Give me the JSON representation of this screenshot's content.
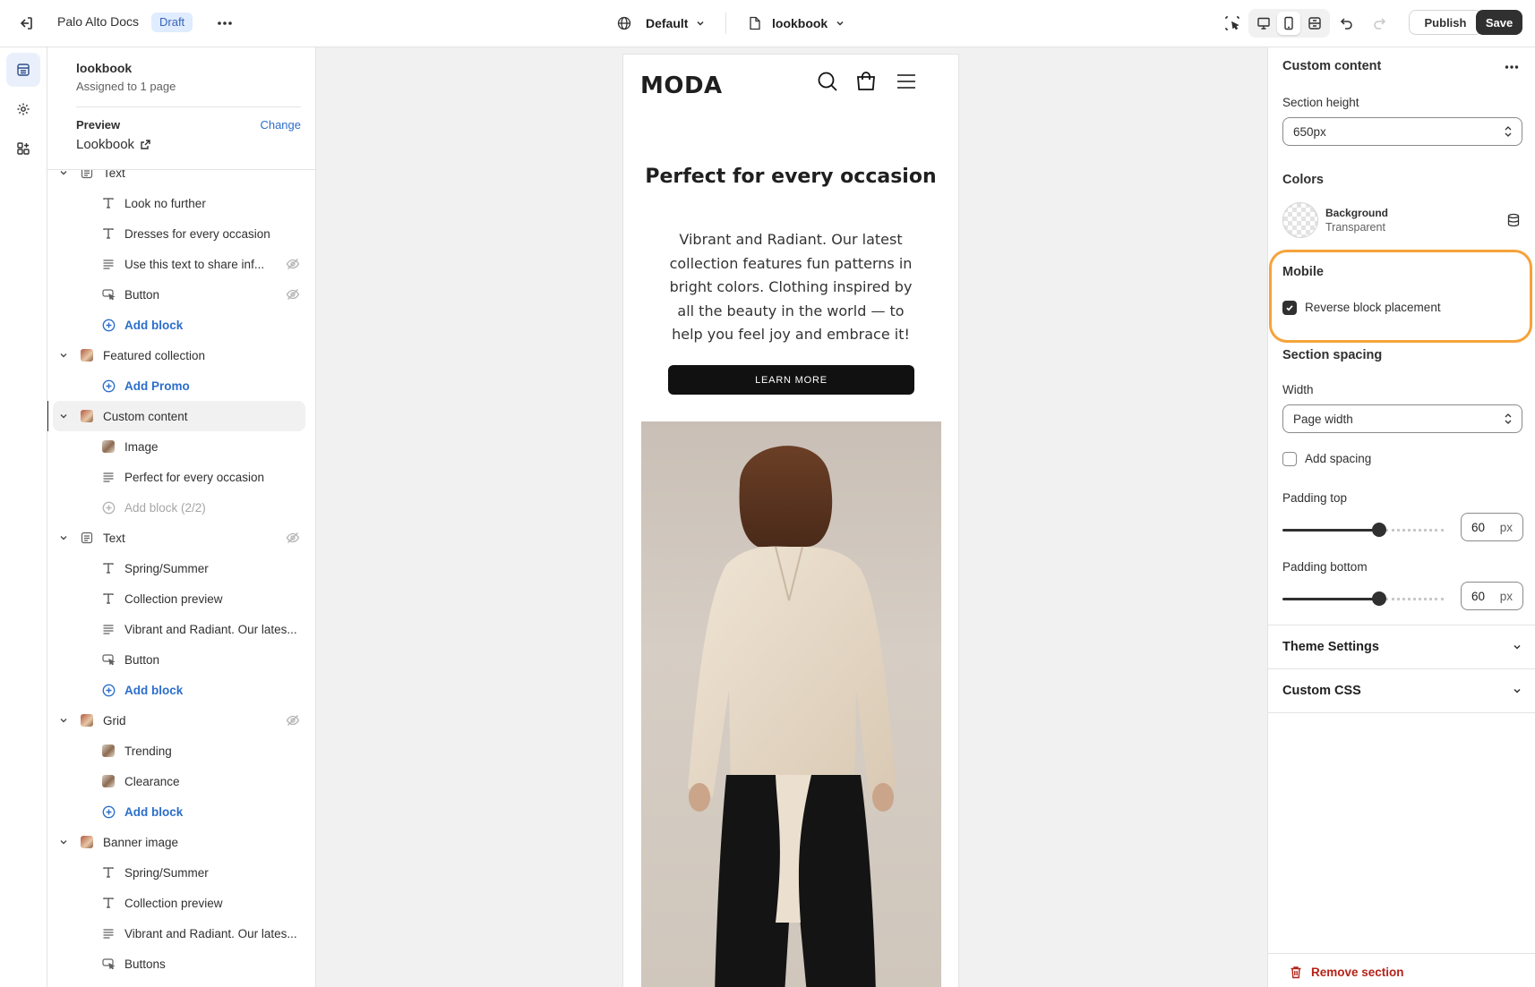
{
  "topbar": {
    "store_name": "Palo Alto Docs",
    "status_badge": "Draft",
    "theme_selector": "Default",
    "page_selector": "lookbook",
    "publish_label": "Publish",
    "save_label": "Save"
  },
  "sidebar": {
    "template_name": "lookbook",
    "assigned": "Assigned to 1 page",
    "preview_label": "Preview",
    "change_label": "Change",
    "preview_value": "Lookbook",
    "tree": [
      {
        "type": "section",
        "label": "Text",
        "icon": "text-section-icon"
      },
      {
        "type": "child",
        "label": "Look no further",
        "icon": "heading-icon"
      },
      {
        "type": "child",
        "label": "Dresses for every occasion",
        "icon": "heading-icon"
      },
      {
        "type": "child",
        "label": "Use this text to share inf...",
        "icon": "paragraph-icon",
        "hidden": true
      },
      {
        "type": "child",
        "label": "Button",
        "icon": "button-icon",
        "hidden": true
      },
      {
        "type": "add",
        "label": "Add block"
      },
      {
        "type": "section",
        "label": "Featured collection",
        "icon": "thumbnail-icon"
      },
      {
        "type": "add",
        "label": "Add Promo"
      },
      {
        "type": "section",
        "label": "Custom content",
        "icon": "thumbnail-icon",
        "selected": true
      },
      {
        "type": "child",
        "label": "Image",
        "icon": "image-thumbnail-icon"
      },
      {
        "type": "child",
        "label": "Perfect for every occasion",
        "icon": "paragraph-icon"
      },
      {
        "type": "add-disabled",
        "label": "Add block (2/2)"
      },
      {
        "type": "section",
        "label": "Text",
        "icon": "text-section-icon",
        "hidden": true
      },
      {
        "type": "child",
        "label": "Spring/Summer",
        "icon": "heading-icon"
      },
      {
        "type": "child",
        "label": "Collection preview",
        "icon": "heading-icon"
      },
      {
        "type": "child",
        "label": "Vibrant and Radiant. Our lates...",
        "icon": "paragraph-icon"
      },
      {
        "type": "child",
        "label": "Button",
        "icon": "button-icon"
      },
      {
        "type": "add",
        "label": "Add block"
      },
      {
        "type": "section",
        "label": "Grid",
        "icon": "thumbnail-icon",
        "hidden": true
      },
      {
        "type": "child",
        "label": "Trending",
        "icon": "image-thumbnail-icon"
      },
      {
        "type": "child",
        "label": "Clearance",
        "icon": "image-thumbnail-icon"
      },
      {
        "type": "add",
        "label": "Add block"
      },
      {
        "type": "section",
        "label": "Banner image",
        "icon": "thumbnail-icon"
      },
      {
        "type": "child",
        "label": "Spring/Summer",
        "icon": "heading-icon"
      },
      {
        "type": "child",
        "label": "Collection preview",
        "icon": "heading-icon"
      },
      {
        "type": "child",
        "label": "Vibrant and Radiant. Our lates...",
        "icon": "paragraph-icon"
      },
      {
        "type": "child",
        "label": "Buttons",
        "icon": "button-icon"
      }
    ]
  },
  "preview": {
    "logo": "MODA",
    "hero_title": "Perfect for every occasion",
    "hero_body": "Vibrant and Radiant. Our latest collection features fun patterns in bright colors. Clothing inspired by all the beauty in the world — to help you feel joy and embrace it!",
    "hero_button": "LEARN MORE"
  },
  "panel": {
    "title": "Custom content",
    "section_height_label": "Section height",
    "section_height_value": "650px",
    "colors_heading": "Colors",
    "background_label": "Background",
    "background_value": "Transparent",
    "mobile_heading": "Mobile",
    "reverse_label": "Reverse block placement",
    "reverse_checked": true,
    "spacing_heading": "Section spacing",
    "width_label": "Width",
    "width_value": "Page width",
    "add_spacing_label": "Add spacing",
    "add_spacing_checked": false,
    "padding_top_label": "Padding top",
    "padding_top_value": "60",
    "padding_bottom_label": "Padding bottom",
    "padding_bottom_value": "60",
    "unit": "px",
    "theme_settings": "Theme Settings",
    "custom_css": "Custom CSS",
    "remove_section": "Remove section"
  },
  "colors": {
    "accent_link": "#2c6ecb",
    "highlight": "#f5a33a",
    "danger": "#b42318"
  }
}
